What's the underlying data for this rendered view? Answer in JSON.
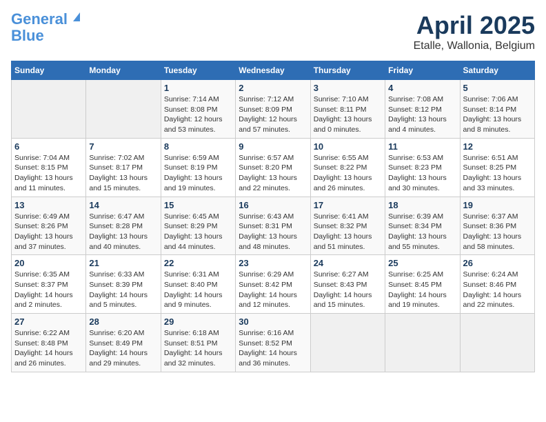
{
  "header": {
    "logo_line1": "General",
    "logo_line2": "Blue",
    "title": "April 2025",
    "subtitle": "Etalle, Wallonia, Belgium"
  },
  "weekdays": [
    "Sunday",
    "Monday",
    "Tuesday",
    "Wednesday",
    "Thursday",
    "Friday",
    "Saturday"
  ],
  "weeks": [
    [
      null,
      null,
      {
        "day": 1,
        "sunrise": "Sunrise: 7:14 AM",
        "sunset": "Sunset: 8:08 PM",
        "daylight": "Daylight: 12 hours and 53 minutes."
      },
      {
        "day": 2,
        "sunrise": "Sunrise: 7:12 AM",
        "sunset": "Sunset: 8:09 PM",
        "daylight": "Daylight: 12 hours and 57 minutes."
      },
      {
        "day": 3,
        "sunrise": "Sunrise: 7:10 AM",
        "sunset": "Sunset: 8:11 PM",
        "daylight": "Daylight: 13 hours and 0 minutes."
      },
      {
        "day": 4,
        "sunrise": "Sunrise: 7:08 AM",
        "sunset": "Sunset: 8:12 PM",
        "daylight": "Daylight: 13 hours and 4 minutes."
      },
      {
        "day": 5,
        "sunrise": "Sunrise: 7:06 AM",
        "sunset": "Sunset: 8:14 PM",
        "daylight": "Daylight: 13 hours and 8 minutes."
      }
    ],
    [
      {
        "day": 6,
        "sunrise": "Sunrise: 7:04 AM",
        "sunset": "Sunset: 8:15 PM",
        "daylight": "Daylight: 13 hours and 11 minutes."
      },
      {
        "day": 7,
        "sunrise": "Sunrise: 7:02 AM",
        "sunset": "Sunset: 8:17 PM",
        "daylight": "Daylight: 13 hours and 15 minutes."
      },
      {
        "day": 8,
        "sunrise": "Sunrise: 6:59 AM",
        "sunset": "Sunset: 8:19 PM",
        "daylight": "Daylight: 13 hours and 19 minutes."
      },
      {
        "day": 9,
        "sunrise": "Sunrise: 6:57 AM",
        "sunset": "Sunset: 8:20 PM",
        "daylight": "Daylight: 13 hours and 22 minutes."
      },
      {
        "day": 10,
        "sunrise": "Sunrise: 6:55 AM",
        "sunset": "Sunset: 8:22 PM",
        "daylight": "Daylight: 13 hours and 26 minutes."
      },
      {
        "day": 11,
        "sunrise": "Sunrise: 6:53 AM",
        "sunset": "Sunset: 8:23 PM",
        "daylight": "Daylight: 13 hours and 30 minutes."
      },
      {
        "day": 12,
        "sunrise": "Sunrise: 6:51 AM",
        "sunset": "Sunset: 8:25 PM",
        "daylight": "Daylight: 13 hours and 33 minutes."
      }
    ],
    [
      {
        "day": 13,
        "sunrise": "Sunrise: 6:49 AM",
        "sunset": "Sunset: 8:26 PM",
        "daylight": "Daylight: 13 hours and 37 minutes."
      },
      {
        "day": 14,
        "sunrise": "Sunrise: 6:47 AM",
        "sunset": "Sunset: 8:28 PM",
        "daylight": "Daylight: 13 hours and 40 minutes."
      },
      {
        "day": 15,
        "sunrise": "Sunrise: 6:45 AM",
        "sunset": "Sunset: 8:29 PM",
        "daylight": "Daylight: 13 hours and 44 minutes."
      },
      {
        "day": 16,
        "sunrise": "Sunrise: 6:43 AM",
        "sunset": "Sunset: 8:31 PM",
        "daylight": "Daylight: 13 hours and 48 minutes."
      },
      {
        "day": 17,
        "sunrise": "Sunrise: 6:41 AM",
        "sunset": "Sunset: 8:32 PM",
        "daylight": "Daylight: 13 hours and 51 minutes."
      },
      {
        "day": 18,
        "sunrise": "Sunrise: 6:39 AM",
        "sunset": "Sunset: 8:34 PM",
        "daylight": "Daylight: 13 hours and 55 minutes."
      },
      {
        "day": 19,
        "sunrise": "Sunrise: 6:37 AM",
        "sunset": "Sunset: 8:36 PM",
        "daylight": "Daylight: 13 hours and 58 minutes."
      }
    ],
    [
      {
        "day": 20,
        "sunrise": "Sunrise: 6:35 AM",
        "sunset": "Sunset: 8:37 PM",
        "daylight": "Daylight: 14 hours and 2 minutes."
      },
      {
        "day": 21,
        "sunrise": "Sunrise: 6:33 AM",
        "sunset": "Sunset: 8:39 PM",
        "daylight": "Daylight: 14 hours and 5 minutes."
      },
      {
        "day": 22,
        "sunrise": "Sunrise: 6:31 AM",
        "sunset": "Sunset: 8:40 PM",
        "daylight": "Daylight: 14 hours and 9 minutes."
      },
      {
        "day": 23,
        "sunrise": "Sunrise: 6:29 AM",
        "sunset": "Sunset: 8:42 PM",
        "daylight": "Daylight: 14 hours and 12 minutes."
      },
      {
        "day": 24,
        "sunrise": "Sunrise: 6:27 AM",
        "sunset": "Sunset: 8:43 PM",
        "daylight": "Daylight: 14 hours and 15 minutes."
      },
      {
        "day": 25,
        "sunrise": "Sunrise: 6:25 AM",
        "sunset": "Sunset: 8:45 PM",
        "daylight": "Daylight: 14 hours and 19 minutes."
      },
      {
        "day": 26,
        "sunrise": "Sunrise: 6:24 AM",
        "sunset": "Sunset: 8:46 PM",
        "daylight": "Daylight: 14 hours and 22 minutes."
      }
    ],
    [
      {
        "day": 27,
        "sunrise": "Sunrise: 6:22 AM",
        "sunset": "Sunset: 8:48 PM",
        "daylight": "Daylight: 14 hours and 26 minutes."
      },
      {
        "day": 28,
        "sunrise": "Sunrise: 6:20 AM",
        "sunset": "Sunset: 8:49 PM",
        "daylight": "Daylight: 14 hours and 29 minutes."
      },
      {
        "day": 29,
        "sunrise": "Sunrise: 6:18 AM",
        "sunset": "Sunset: 8:51 PM",
        "daylight": "Daylight: 14 hours and 32 minutes."
      },
      {
        "day": 30,
        "sunrise": "Sunrise: 6:16 AM",
        "sunset": "Sunset: 8:52 PM",
        "daylight": "Daylight: 14 hours and 36 minutes."
      },
      null,
      null,
      null
    ]
  ]
}
